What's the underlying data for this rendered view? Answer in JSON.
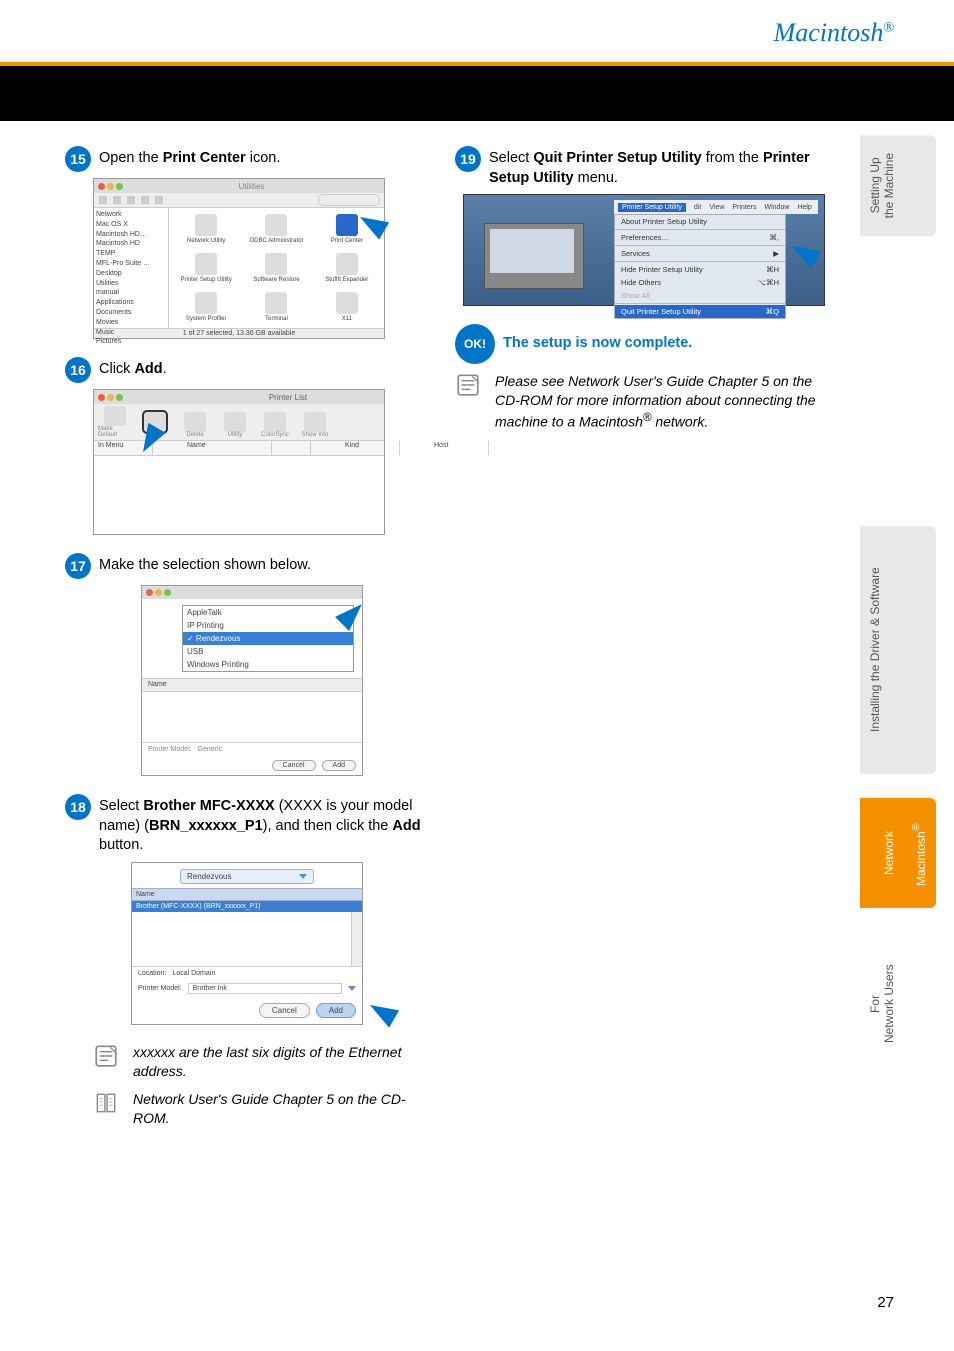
{
  "header": {
    "brand": "Macintosh",
    "brand_sup": "®"
  },
  "page_number": "27",
  "tabs": {
    "t1": "Setting Up\nthe Machine",
    "t2": "Installing the Driver & Software",
    "t3_top": "Macintosh",
    "t3_sup": "®",
    "t3_bottom": "Network",
    "t4": "For\nNetwork Users"
  },
  "steps": {
    "s15": {
      "n": "15",
      "text_a": "Open the ",
      "bold": "Print Center",
      "text_b": " icon."
    },
    "s16": {
      "n": "16",
      "text_a": "Click ",
      "bold": "Add",
      "text_b": "."
    },
    "s17": {
      "n": "17",
      "text": "Make the selection shown below."
    },
    "s18": {
      "n": "18",
      "t1": "Select ",
      "b1": "Brother MFC-XXXX",
      "t2": " (XXXX is your model name) (",
      "b2": "BRN_xxxxxx_P1",
      "t3": "), and then click the ",
      "b3": "Add",
      "t4": " button."
    },
    "s19": {
      "n": "19",
      "t1": "Select ",
      "b1": "Quit Printer Setup Utility",
      "t2": " from the ",
      "b2": "Printer Setup Utility",
      "t3": " menu."
    }
  },
  "ok": {
    "badge": "OK!",
    "text": "The setup is now complete."
  },
  "note1": {
    "text": "xxxxxx are the last six digits of the Ethernet address."
  },
  "note2": {
    "text": "Network User's Guide Chapter 5 on the CD-ROM."
  },
  "note3": {
    "t1": "Please see Network User's Guide Chapter 5 on the CD-ROM for more information about connecting the machine to a Macintosh",
    "sup": "®",
    "t2": " network."
  },
  "fig15": {
    "title": "Utilities",
    "search_placeholder": "Q-",
    "side": [
      "Network",
      "Mac OS X",
      "Macintosh HD…",
      "Macintosh HD",
      "TEMP",
      "MFL-Pro Suite …",
      "",
      "Desktop",
      "Utilities",
      "manual",
      "Applications",
      "Documents",
      "Movies",
      "Music",
      "Pictures"
    ],
    "cells": [
      "Network Utility",
      "ODBC Administrator",
      "Print Center",
      "Printer Setup Utility",
      "Software Restore",
      "StuffIt Expander",
      "System Profiler",
      "Terminal",
      "X11"
    ],
    "status": "1 of 27 selected, 13.36 GB available"
  },
  "fig16": {
    "title": "Printer List",
    "btns": [
      "Make Default",
      "Add",
      "Delete",
      "Utility",
      "ColorSync",
      "Show Info"
    ],
    "cols": [
      "In Menu",
      "Name",
      "",
      "Kind",
      "Host"
    ]
  },
  "fig17": {
    "opts": [
      "AppleTalk",
      "IP Printing",
      "Rendezvous",
      "USB",
      "Windows Printing"
    ],
    "sel_index": 2,
    "printer_model_label": "Printer Model:",
    "printer_model_value": "Generic",
    "name_label": "Name",
    "cancel": "Cancel",
    "add": "Add"
  },
  "fig18": {
    "droplabel": "Rendezvous",
    "name_header": "Name",
    "row": "Brother (MFC-XXXX) (BRN_xxxxxx_P1)",
    "location_label": "Location:",
    "location_value": "Local Domain",
    "pm_label": "Printer Model:",
    "pm_value": "Brother Ink",
    "cancel": "Cancel",
    "add": "Add"
  },
  "fig19": {
    "menubar": [
      "Printer Setup Utility",
      "dit",
      "View",
      "Printers",
      "Window",
      "Help"
    ],
    "menu_title": "About Printer Setup Utility",
    "items": [
      {
        "l": "Preferences…",
        "r": "⌘,"
      },
      {
        "l": "Services",
        "r": "▶"
      },
      {
        "l": "Hide Printer Setup Utility",
        "r": "⌘H"
      },
      {
        "l": "Hide Others",
        "r": "⌥⌘H"
      },
      {
        "l": "Show All",
        "r": "",
        "dis": true
      },
      {
        "l": "Quit Printer Setup Utility",
        "r": "⌘Q",
        "hi": true
      }
    ]
  }
}
